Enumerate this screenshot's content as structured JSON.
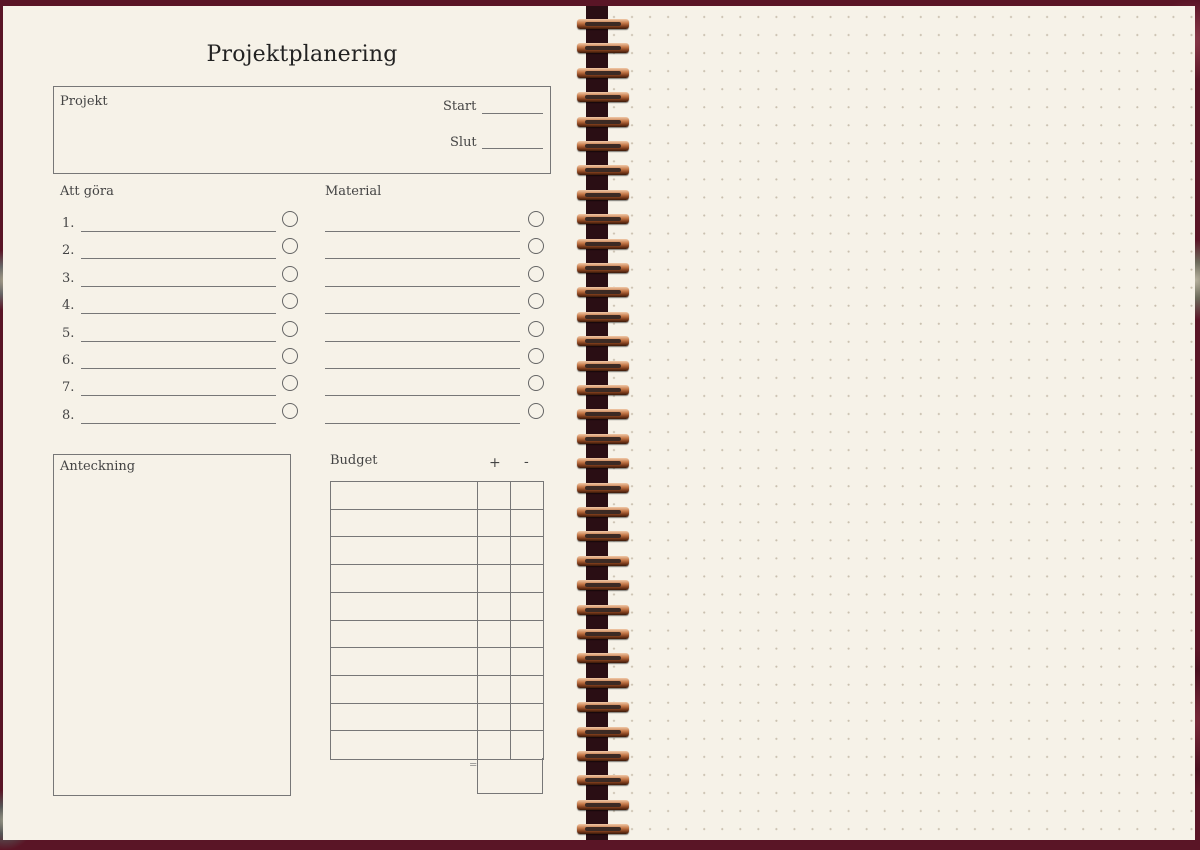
{
  "page_title": "Projektplanering",
  "project": {
    "label": "Projekt",
    "start_label": "Start",
    "end_label": "Slut"
  },
  "todo": {
    "label": "Att göra",
    "numbers": [
      "1.",
      "2.",
      "3.",
      "4.",
      "5.",
      "6.",
      "7.",
      "8."
    ]
  },
  "material": {
    "label": "Material"
  },
  "notes": {
    "label": "Anteckning"
  },
  "budget": {
    "label": "Budget",
    "plus": "+",
    "minus": "-",
    "equals": "="
  },
  "colors": {
    "cover": "#5a1526",
    "paper": "#f6f2e8",
    "ring": "#c77a4a"
  }
}
